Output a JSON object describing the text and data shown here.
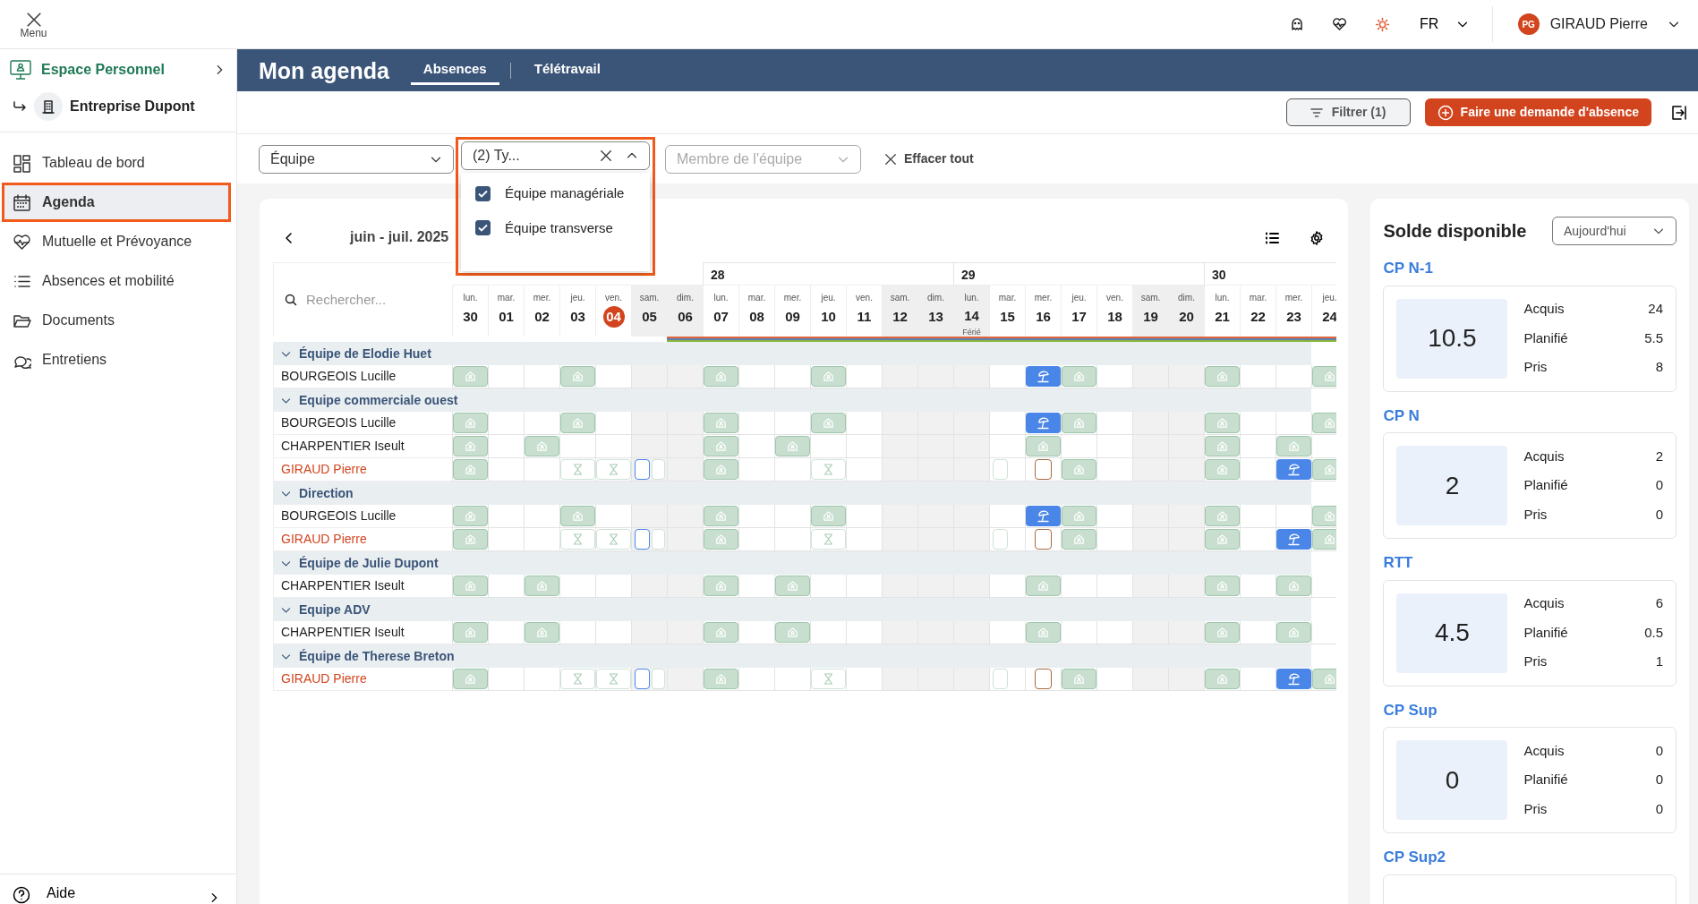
{
  "topbar": {
    "menu_label": "Menu",
    "language": "FR",
    "user": {
      "initials": "PG",
      "name": "GIRAUD Pierre"
    }
  },
  "sidebar": {
    "space": "Espace Personnel",
    "company": "Entreprise Dupont",
    "items": [
      {
        "label": "Tableau de bord",
        "selected": false
      },
      {
        "label": "Agenda",
        "selected": true
      },
      {
        "label": "Mutuelle et Prévoyance",
        "selected": false
      },
      {
        "label": "Absences et mobilité",
        "selected": false
      },
      {
        "label": "Documents",
        "selected": false
      },
      {
        "label": "Entretiens",
        "selected": false
      }
    ],
    "help": "Aide"
  },
  "header": {
    "title": "Mon agenda",
    "tabs": [
      {
        "label": "Absences",
        "selected": true
      },
      {
        "label": "Télétravail",
        "selected": false
      }
    ]
  },
  "actions": {
    "filter_button": "Filtrer (1)",
    "request_button": "Faire une demande d'absence"
  },
  "filters": [
    {
      "kind": "select",
      "value": "Équipe"
    },
    {
      "kind": "multiselect",
      "value": "(2) Ty...",
      "expanded": true,
      "options": [
        {
          "label": "Équipe managériale",
          "checked": true
        },
        {
          "label": "Équipe transverse",
          "checked": true
        }
      ]
    },
    {
      "kind": "select",
      "placeholder": "Membre de l'équipe"
    }
  ],
  "clear_all": "Effacer tout",
  "calendar": {
    "period": "juin - juil. 2025",
    "search_placeholder": "Rechercher...",
    "days": [
      {
        "dow": "lun.",
        "num": "30",
        "today": false,
        "off": false
      },
      {
        "dow": "mar.",
        "num": "01",
        "today": false,
        "off": false
      },
      {
        "dow": "mer.",
        "num": "02",
        "today": false,
        "off": false
      },
      {
        "dow": "jeu.",
        "num": "03",
        "today": false,
        "off": false
      },
      {
        "dow": "ven.",
        "num": "04",
        "today": true,
        "off": false
      },
      {
        "dow": "sam.",
        "num": "05",
        "today": false,
        "off": true
      },
      {
        "dow": "dim.",
        "num": "06",
        "today": false,
        "off": true
      },
      {
        "dow": "lun.",
        "num": "07",
        "today": false,
        "off": false,
        "week": "28"
      },
      {
        "dow": "mar.",
        "num": "08",
        "today": false,
        "off": false
      },
      {
        "dow": "mer.",
        "num": "09",
        "today": false,
        "off": false
      },
      {
        "dow": "jeu.",
        "num": "10",
        "today": false,
        "off": false
      },
      {
        "dow": "ven.",
        "num": "11",
        "today": false,
        "off": false
      },
      {
        "dow": "sam.",
        "num": "12",
        "today": false,
        "off": true
      },
      {
        "dow": "dim.",
        "num": "13",
        "today": false,
        "off": true
      },
      {
        "dow": "lun.",
        "num": "14",
        "today": false,
        "off": true,
        "week": "29",
        "note": "Férié"
      },
      {
        "dow": "mar.",
        "num": "15",
        "today": false,
        "off": false
      },
      {
        "dow": "mer.",
        "num": "16",
        "today": false,
        "off": false
      },
      {
        "dow": "jeu.",
        "num": "17",
        "today": false,
        "off": false
      },
      {
        "dow": "ven.",
        "num": "18",
        "today": false,
        "off": false
      },
      {
        "dow": "sam.",
        "num": "19",
        "today": false,
        "off": true
      },
      {
        "dow": "dim.",
        "num": "20",
        "today": false,
        "off": true
      },
      {
        "dow": "lun.",
        "num": "21",
        "today": false,
        "off": false,
        "week": "30"
      },
      {
        "dow": "mar.",
        "num": "22",
        "today": false,
        "off": false
      },
      {
        "dow": "mer.",
        "num": "23",
        "today": false,
        "off": false
      },
      {
        "dow": "jeu.",
        "num": "24",
        "today": false,
        "off": false
      }
    ],
    "groups": [
      {
        "name": "Équipe de Elodie Huet",
        "expanded": true,
        "members": [
          {
            "name": "BOURGEOIS Lucille",
            "highlighted": false,
            "cells": [
              {
                "kind": "telework"
              },
              {
                "kind": "empty"
              },
              {
                "kind": "empty"
              },
              {
                "kind": "telework"
              },
              {
                "kind": "empty"
              },
              {
                "kind": "empty"
              },
              {
                "kind": "empty"
              },
              {
                "kind": "telework"
              },
              {
                "kind": "empty"
              },
              {
                "kind": "empty"
              },
              {
                "kind": "telework"
              },
              {
                "kind": "empty"
              },
              {
                "kind": "empty"
              },
              {
                "kind": "empty"
              },
              {
                "kind": "empty"
              },
              {
                "kind": "empty"
              },
              {
                "kind": "vacation"
              },
              {
                "kind": "telework"
              },
              {
                "kind": "empty"
              },
              {
                "kind": "empty"
              },
              {
                "kind": "empty"
              },
              {
                "kind": "telework"
              },
              {
                "kind": "empty"
              },
              {
                "kind": "empty"
              },
              {
                "kind": "telework"
              }
            ]
          }
        ]
      },
      {
        "name": "Equipe commerciale ouest",
        "expanded": true,
        "members": [
          {
            "name": "BOURGEOIS Lucille",
            "highlighted": false,
            "cells": [
              {
                "kind": "telework"
              },
              {
                "kind": "empty"
              },
              {
                "kind": "empty"
              },
              {
                "kind": "telework"
              },
              {
                "kind": "empty"
              },
              {
                "kind": "empty"
              },
              {
                "kind": "empty"
              },
              {
                "kind": "telework"
              },
              {
                "kind": "empty"
              },
              {
                "kind": "empty"
              },
              {
                "kind": "telework"
              },
              {
                "kind": "empty"
              },
              {
                "kind": "empty"
              },
              {
                "kind": "empty"
              },
              {
                "kind": "empty"
              },
              {
                "kind": "empty"
              },
              {
                "kind": "vacation"
              },
              {
                "kind": "telework"
              },
              {
                "kind": "empty"
              },
              {
                "kind": "empty"
              },
              {
                "kind": "empty"
              },
              {
                "kind": "telework"
              },
              {
                "kind": "empty"
              },
              {
                "kind": "empty"
              },
              {
                "kind": "telework"
              }
            ]
          },
          {
            "name": "CHARPENTIER Iseult",
            "highlighted": false,
            "cells": [
              {
                "kind": "telework"
              },
              {
                "kind": "empty"
              },
              {
                "kind": "telework"
              },
              {
                "kind": "empty"
              },
              {
                "kind": "empty"
              },
              {
                "kind": "empty"
              },
              {
                "kind": "empty"
              },
              {
                "kind": "telework"
              },
              {
                "kind": "empty"
              },
              {
                "kind": "telework"
              },
              {
                "kind": "empty"
              },
              {
                "kind": "empty"
              },
              {
                "kind": "empty"
              },
              {
                "kind": "empty"
              },
              {
                "kind": "empty"
              },
              {
                "kind": "empty"
              },
              {
                "kind": "telework"
              },
              {
                "kind": "empty"
              },
              {
                "kind": "empty"
              },
              {
                "kind": "empty"
              },
              {
                "kind": "empty"
              },
              {
                "kind": "telework"
              },
              {
                "kind": "empty"
              },
              {
                "kind": "telework"
              },
              {
                "kind": "empty"
              }
            ]
          },
          {
            "name": "GIRAUD Pierre",
            "highlighted": true,
            "cells": [
              {
                "kind": "telework"
              },
              {
                "kind": "empty"
              },
              {
                "kind": "empty"
              },
              {
                "kind": "pending"
              },
              {
                "kind": "pending"
              },
              {
                "kind": "split"
              },
              {
                "kind": "empty"
              },
              {
                "kind": "telework"
              },
              {
                "kind": "empty"
              },
              {
                "kind": "empty"
              },
              {
                "kind": "pending"
              },
              {
                "kind": "empty"
              },
              {
                "kind": "empty"
              },
              {
                "kind": "empty"
              },
              {
                "kind": "empty"
              },
              {
                "kind": "half"
              },
              {
                "kind": "outlined"
              },
              {
                "kind": "telework"
              },
              {
                "kind": "empty"
              },
              {
                "kind": "empty"
              },
              {
                "kind": "empty"
              },
              {
                "kind": "telework"
              },
              {
                "kind": "empty"
              },
              {
                "kind": "vacation"
              },
              {
                "kind": "telework"
              }
            ]
          }
        ]
      },
      {
        "name": "Direction",
        "expanded": true,
        "members": [
          {
            "name": "BOURGEOIS Lucille",
            "highlighted": false,
            "cells": [
              {
                "kind": "telework"
              },
              {
                "kind": "empty"
              },
              {
                "kind": "empty"
              },
              {
                "kind": "telework"
              },
              {
                "kind": "empty"
              },
              {
                "kind": "empty"
              },
              {
                "kind": "empty"
              },
              {
                "kind": "telework"
              },
              {
                "kind": "empty"
              },
              {
                "kind": "empty"
              },
              {
                "kind": "telework"
              },
              {
                "kind": "empty"
              },
              {
                "kind": "empty"
              },
              {
                "kind": "empty"
              },
              {
                "kind": "empty"
              },
              {
                "kind": "empty"
              },
              {
                "kind": "vacation"
              },
              {
                "kind": "telework"
              },
              {
                "kind": "empty"
              },
              {
                "kind": "empty"
              },
              {
                "kind": "empty"
              },
              {
                "kind": "telework"
              },
              {
                "kind": "empty"
              },
              {
                "kind": "empty"
              },
              {
                "kind": "telework"
              }
            ]
          },
          {
            "name": "GIRAUD Pierre",
            "highlighted": true,
            "cells": [
              {
                "kind": "telework"
              },
              {
                "kind": "empty"
              },
              {
                "kind": "empty"
              },
              {
                "kind": "pending"
              },
              {
                "kind": "pending"
              },
              {
                "kind": "split"
              },
              {
                "kind": "empty"
              },
              {
                "kind": "telework"
              },
              {
                "kind": "empty"
              },
              {
                "kind": "empty"
              },
              {
                "kind": "pending"
              },
              {
                "kind": "empty"
              },
              {
                "kind": "empty"
              },
              {
                "kind": "empty"
              },
              {
                "kind": "empty"
              },
              {
                "kind": "half"
              },
              {
                "kind": "outlined"
              },
              {
                "kind": "telework"
              },
              {
                "kind": "empty"
              },
              {
                "kind": "empty"
              },
              {
                "kind": "empty"
              },
              {
                "kind": "telework"
              },
              {
                "kind": "empty"
              },
              {
                "kind": "vacation"
              },
              {
                "kind": "telework"
              }
            ]
          }
        ]
      },
      {
        "name": "Équipe de Julie Dupont",
        "expanded": true,
        "members": [
          {
            "name": "CHARPENTIER Iseult",
            "highlighted": false,
            "cells": [
              {
                "kind": "telework"
              },
              {
                "kind": "empty"
              },
              {
                "kind": "telework"
              },
              {
                "kind": "empty"
              },
              {
                "kind": "empty"
              },
              {
                "kind": "empty"
              },
              {
                "kind": "empty"
              },
              {
                "kind": "telework"
              },
              {
                "kind": "empty"
              },
              {
                "kind": "telework"
              },
              {
                "kind": "empty"
              },
              {
                "kind": "empty"
              },
              {
                "kind": "empty"
              },
              {
                "kind": "empty"
              },
              {
                "kind": "empty"
              },
              {
                "kind": "empty"
              },
              {
                "kind": "telework"
              },
              {
                "kind": "empty"
              },
              {
                "kind": "empty"
              },
              {
                "kind": "empty"
              },
              {
                "kind": "empty"
              },
              {
                "kind": "telework"
              },
              {
                "kind": "empty"
              },
              {
                "kind": "telework"
              },
              {
                "kind": "empty"
              }
            ]
          }
        ]
      },
      {
        "name": "Equipe ADV",
        "expanded": true,
        "members": [
          {
            "name": "CHARPENTIER Iseult",
            "highlighted": false,
            "cells": [
              {
                "kind": "telework"
              },
              {
                "kind": "empty"
              },
              {
                "kind": "telework"
              },
              {
                "kind": "empty"
              },
              {
                "kind": "empty"
              },
              {
                "kind": "empty"
              },
              {
                "kind": "empty"
              },
              {
                "kind": "telework"
              },
              {
                "kind": "empty"
              },
              {
                "kind": "telework"
              },
              {
                "kind": "empty"
              },
              {
                "kind": "empty"
              },
              {
                "kind": "empty"
              },
              {
                "kind": "empty"
              },
              {
                "kind": "empty"
              },
              {
                "kind": "empty"
              },
              {
                "kind": "telework"
              },
              {
                "kind": "empty"
              },
              {
                "kind": "empty"
              },
              {
                "kind": "empty"
              },
              {
                "kind": "empty"
              },
              {
                "kind": "telework"
              },
              {
                "kind": "empty"
              },
              {
                "kind": "telework"
              },
              {
                "kind": "empty"
              }
            ]
          }
        ]
      },
      {
        "name": "Équipe de Therese Breton",
        "expanded": true,
        "members": [
          {
            "name": "GIRAUD Pierre",
            "highlighted": true,
            "cells": [
              {
                "kind": "telework"
              },
              {
                "kind": "empty"
              },
              {
                "kind": "empty"
              },
              {
                "kind": "pending"
              },
              {
                "kind": "pending"
              },
              {
                "kind": "split"
              },
              {
                "kind": "empty"
              },
              {
                "kind": "telework"
              },
              {
                "kind": "empty"
              },
              {
                "kind": "empty"
              },
              {
                "kind": "pending"
              },
              {
                "kind": "empty"
              },
              {
                "kind": "empty"
              },
              {
                "kind": "empty"
              },
              {
                "kind": "empty"
              },
              {
                "kind": "half"
              },
              {
                "kind": "outlined"
              },
              {
                "kind": "telework"
              },
              {
                "kind": "empty"
              },
              {
                "kind": "empty"
              },
              {
                "kind": "empty"
              },
              {
                "kind": "telework"
              },
              {
                "kind": "empty"
              },
              {
                "kind": "vacation"
              },
              {
                "kind": "telework"
              }
            ]
          }
        ]
      }
    ]
  },
  "balance": {
    "title": "Solde disponible",
    "period": "Aujourd'hui",
    "accounts": [
      {
        "name": "CP N-1",
        "value": "10.5",
        "rows": [
          {
            "label": "Acquis",
            "value": "24"
          },
          {
            "label": "Planifié",
            "value": "5.5"
          },
          {
            "label": "Pris",
            "value": "8"
          }
        ]
      },
      {
        "name": "CP N",
        "value": "2",
        "rows": [
          {
            "label": "Acquis",
            "value": "2"
          },
          {
            "label": "Planifié",
            "value": "0"
          },
          {
            "label": "Pris",
            "value": "0"
          }
        ]
      },
      {
        "name": "RTT",
        "value": "4.5",
        "rows": [
          {
            "label": "Acquis",
            "value": "6"
          },
          {
            "label": "Planifié",
            "value": "0.5"
          },
          {
            "label": "Pris",
            "value": "1"
          }
        ]
      },
      {
        "name": "CP Sup",
        "value": "0",
        "rows": [
          {
            "label": "Acquis",
            "value": "0"
          },
          {
            "label": "Planifié",
            "value": "0"
          },
          {
            "label": "Pris",
            "value": "0"
          }
        ]
      },
      {
        "name": "CP Sup2"
      }
    ]
  }
}
